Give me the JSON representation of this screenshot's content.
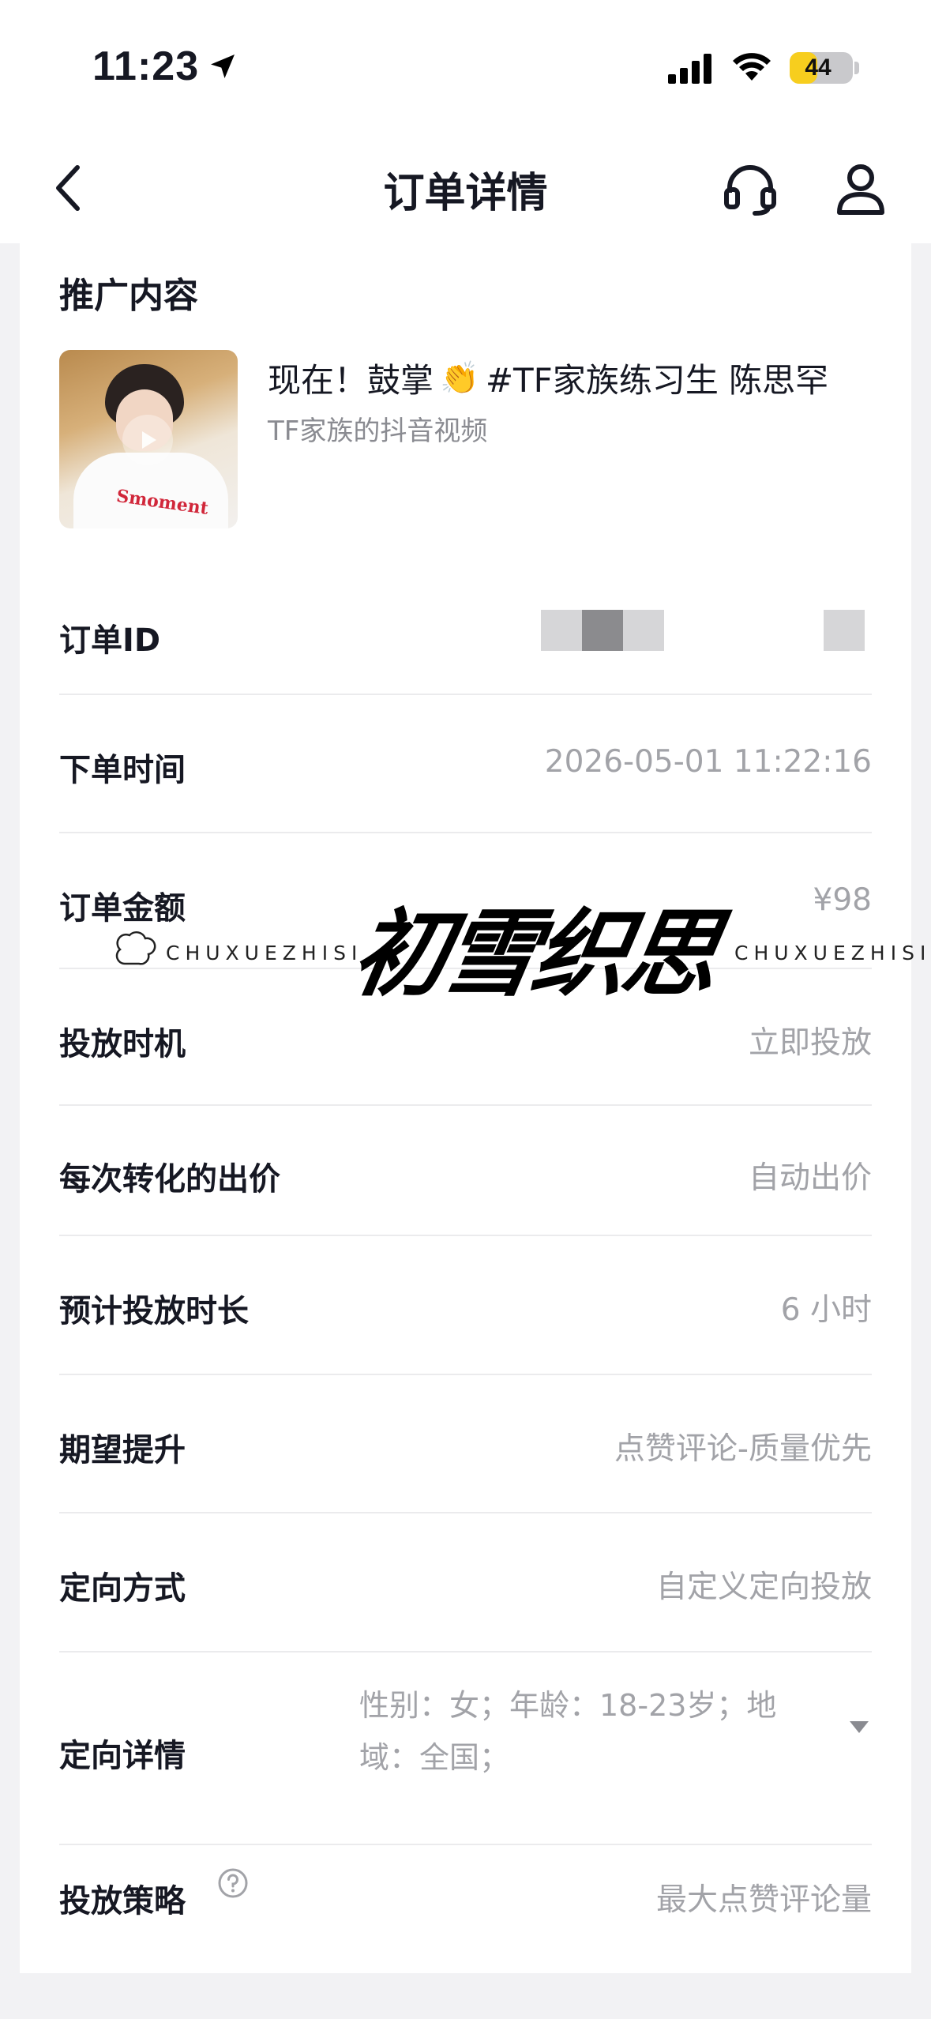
{
  "status_bar": {
    "time": "11:23",
    "battery": "44",
    "battery_level": 0.44,
    "battery_color": "#f7ce1e"
  },
  "nav": {
    "title": "订单详情",
    "back_icon": "chevron-left-icon",
    "support_icon": "headset-icon",
    "profile_icon": "user-icon"
  },
  "promo": {
    "section_title": "推广内容",
    "video_title_prefix": "现在！鼓掌",
    "video_title_emoji": "👏",
    "video_title_suffix": "#TF家族练习生 陈思罕",
    "video_subtitle": "TF家族的抖音视频",
    "thumb_shirt_text": "Smoment"
  },
  "details": {
    "order_id_label": "订单ID",
    "order_time_label": "下单时间",
    "order_time_value": "2026-05-01 11:22:16",
    "amount_label": "订单金额",
    "amount_value": "¥98",
    "timing_label": "投放时机",
    "timing_value": "立即投放",
    "bid_label": "每次转化的出价",
    "bid_value": "自动出价",
    "duration_label": "预计投放时长",
    "duration_value": "6 小时",
    "goal_label": "期望提升",
    "goal_value": "点赞评论-质量优先",
    "targeting_label": "定向方式",
    "targeting_value": "自定义定向投放",
    "targeting_detail_label": "定向详情",
    "targeting_detail_value": "性别：女；年龄：18-23岁；地域：全国；",
    "strategy_label": "投放策略",
    "strategy_value": "最大点赞评论量"
  },
  "watermark": {
    "text_left": "CHUXUEZHISI",
    "text_right": "CHUXUEZHISI",
    "cursive": "初雪织思"
  }
}
